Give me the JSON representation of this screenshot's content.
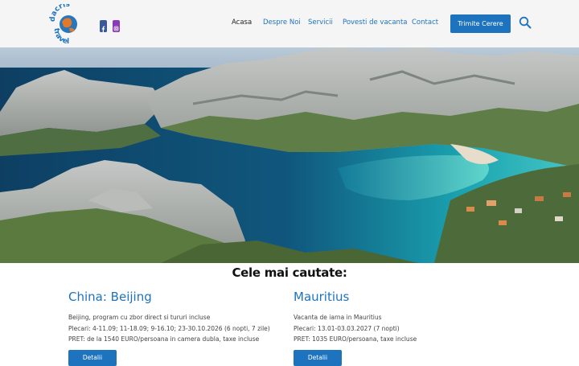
{
  "brand": {
    "logo_icon": "globe-logo",
    "logo_text_top": "dacris",
    "logo_text_bottom": "travel",
    "accent_color": "#1e73be"
  },
  "social": [
    {
      "icon": "facebook-icon",
      "color": "#3b5998"
    },
    {
      "icon": "instagram-icon",
      "color": "#8a3ab9"
    }
  ],
  "nav": {
    "items": [
      {
        "label": "Acasa"
      },
      {
        "label": "Despre Noi"
      },
      {
        "label": "Servicii"
      },
      {
        "label": "Povesti de vacanta"
      },
      {
        "label": "Contact"
      }
    ],
    "active": "Acasa",
    "cta_label": "Trimite Cerere",
    "search_icon": "search-icon"
  },
  "hero": {
    "image": "coastal-calanque-landscape"
  },
  "featured": {
    "title": "Cele mai cautate:",
    "cards": [
      {
        "title": "China: Beijing",
        "lines": [
          "Beijing, program cu zbor direct si tururi incluse",
          "Plecari: 4-11.09; 11-18.09; 9-16.10; 23-30.10.2026 (6 nopti, 7 zile)",
          "PRET: de la 1540 EURO/persoana in camera dubla, taxe incluse"
        ],
        "button": "Detalii"
      },
      {
        "title": "Mauritius",
        "lines": [
          "Vacanta de iarna in Mauritius",
          "Plecari: 13.01-03.03.2027 (7 nopti)",
          "PRET: 1035 EURO/persoana, taxe incluse"
        ],
        "button": "Detalii"
      }
    ]
  }
}
